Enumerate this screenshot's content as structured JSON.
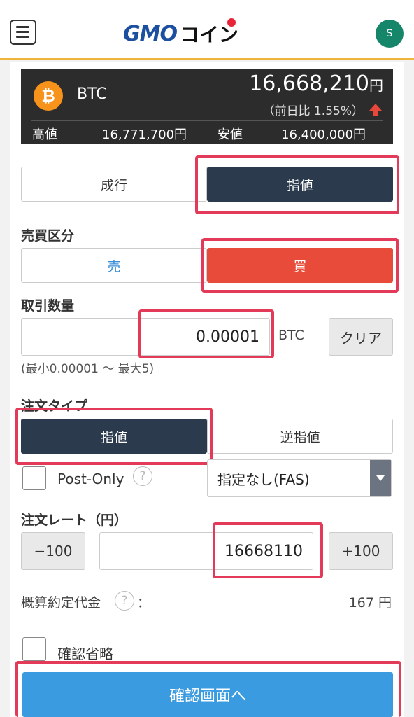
{
  "header": {
    "logo_gmo": "GMO",
    "logo_coin": "コイン",
    "avatar_initial": "S"
  },
  "ticker": {
    "symbol": "BTC",
    "icon_symbol": "₿",
    "price": "16,668,210",
    "price_unit": "円",
    "change": "（前日比 1.55%）",
    "change_direction": "up",
    "high_label": "高値",
    "high_value": "16,771,700円",
    "low_label": "安値",
    "low_value": "16,400,000円"
  },
  "order_method": {
    "market_label": "成行",
    "limit_label": "指値",
    "selected": "指値"
  },
  "side": {
    "section_label": "売買区分",
    "sell_label": "売",
    "buy_label": "買",
    "selected": "買"
  },
  "quantity": {
    "section_label": "取引数量",
    "value": "0.00001",
    "unit": "BTC",
    "clear_label": "クリア",
    "hint": "(最小0.00001 〜 最大5)"
  },
  "order_type": {
    "section_label": "注文タイプ",
    "limit_label": "指値",
    "stop_label": "逆指値",
    "selected": "指値",
    "post_only_label": "Post-Only",
    "post_only_checked": false,
    "help_glyph": "?",
    "fas_value": "指定なし(FAS)"
  },
  "rate": {
    "section_label": "注文レート（円）",
    "minus_label": "−100",
    "value": "16668110",
    "plus_label": "+100"
  },
  "estimate": {
    "label": "概算約定代金",
    "colon": "：",
    "value": "167 円"
  },
  "skip_confirm": {
    "label": "確認省略",
    "checked": false
  },
  "confirm_button_label": "確認画面へ",
  "colors": {
    "highlight": "#e43a5a",
    "dark_selected": "#2b3a4d",
    "buy_red": "#e84b3a",
    "confirm_blue": "#3b9be0",
    "header_accent": "#f0b43c"
  }
}
